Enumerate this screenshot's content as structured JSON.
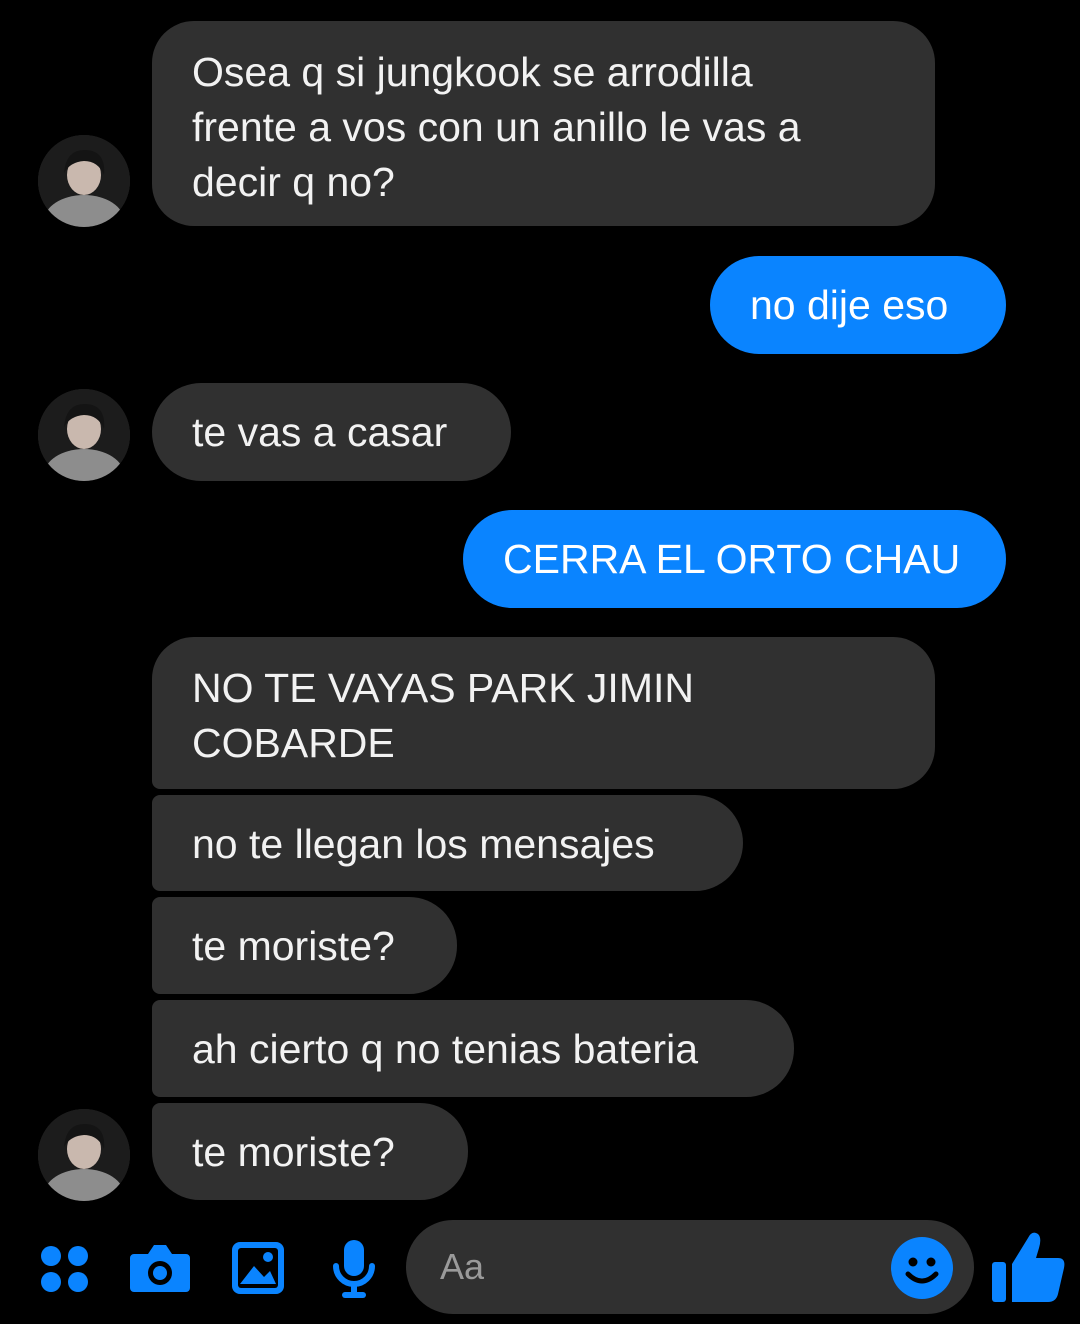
{
  "messages": [
    {
      "from": "them",
      "text": "Osea q si jungkook se arrodilla\nfrente a vos con un anillo le vas a\ndecir q no?"
    },
    {
      "from": "me",
      "text": "no dije eso"
    },
    {
      "from": "them",
      "text": "te vas a casar"
    },
    {
      "from": "me",
      "text": "CERRA EL ORTO CHAU"
    },
    {
      "from": "them",
      "text": "NO TE VAYAS PARK JIMIN\nCOBARDE"
    },
    {
      "from": "them",
      "text": "no te llegan los mensajes"
    },
    {
      "from": "them",
      "text": "te moriste?"
    },
    {
      "from": "them",
      "text": "ah cierto q no tenias bateria"
    },
    {
      "from": "them",
      "text": "te moriste?"
    }
  ],
  "composer": {
    "placeholder": "Aa",
    "icons": [
      "apps-icon",
      "camera-icon",
      "gallery-icon",
      "microphone-icon",
      "emoji-icon",
      "thumbs-up-icon"
    ]
  },
  "colors": {
    "accent": "#0a84ff",
    "incoming_bubble": "#303030",
    "background": "#000000"
  }
}
